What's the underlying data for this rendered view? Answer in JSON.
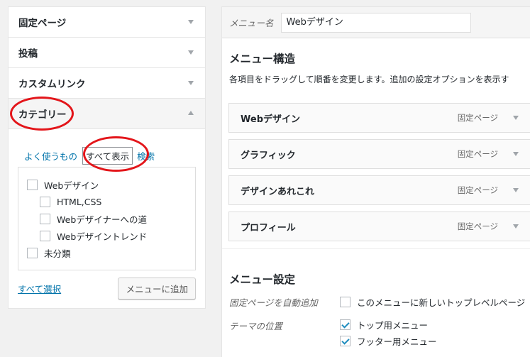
{
  "left_panel": {
    "accordions": [
      {
        "label": "固定ページ"
      },
      {
        "label": "投稿"
      },
      {
        "label": "カスタムリンク"
      },
      {
        "label": "カテゴリー"
      }
    ],
    "category_tabs": {
      "most_used": "よく使うもの",
      "view_all": "すべて表示",
      "search": "検索"
    },
    "categories": [
      {
        "label": "Webデザイン"
      },
      {
        "label": "HTML,CSS"
      },
      {
        "label": "Webデザイナーへの道"
      },
      {
        "label": "Webデザイントレンド"
      },
      {
        "label": "未分類"
      }
    ],
    "select_all": "すべて選択",
    "add_button": "メニューに追加"
  },
  "right_panel": {
    "menu_name_label": "メニュー名",
    "menu_name_value": "Webデザイン",
    "structure_heading": "メニュー構造",
    "structure_desc": "各項目をドラッグして順番を変更します。追加の設定オプションを表示す",
    "items": [
      {
        "title": "Webデザイン",
        "type": "固定ページ"
      },
      {
        "title": "グラフィック",
        "type": "固定ページ"
      },
      {
        "title": "デザインあれこれ",
        "type": "固定ページ"
      },
      {
        "title": "プロフィール",
        "type": "固定ページ"
      }
    ],
    "settings_heading": "メニュー設定",
    "auto_add_label": "固定ページを自動追加",
    "auto_add_text": "このメニューに新しいトップレベルページ",
    "theme_location_label": "テーマの位置",
    "locations": [
      {
        "label": "トップ用メニュー",
        "checked": true
      },
      {
        "label": "フッター用メニュー",
        "checked": true
      }
    ]
  },
  "colors": {
    "link": "#0073aa",
    "annotation": "#e3151a"
  }
}
